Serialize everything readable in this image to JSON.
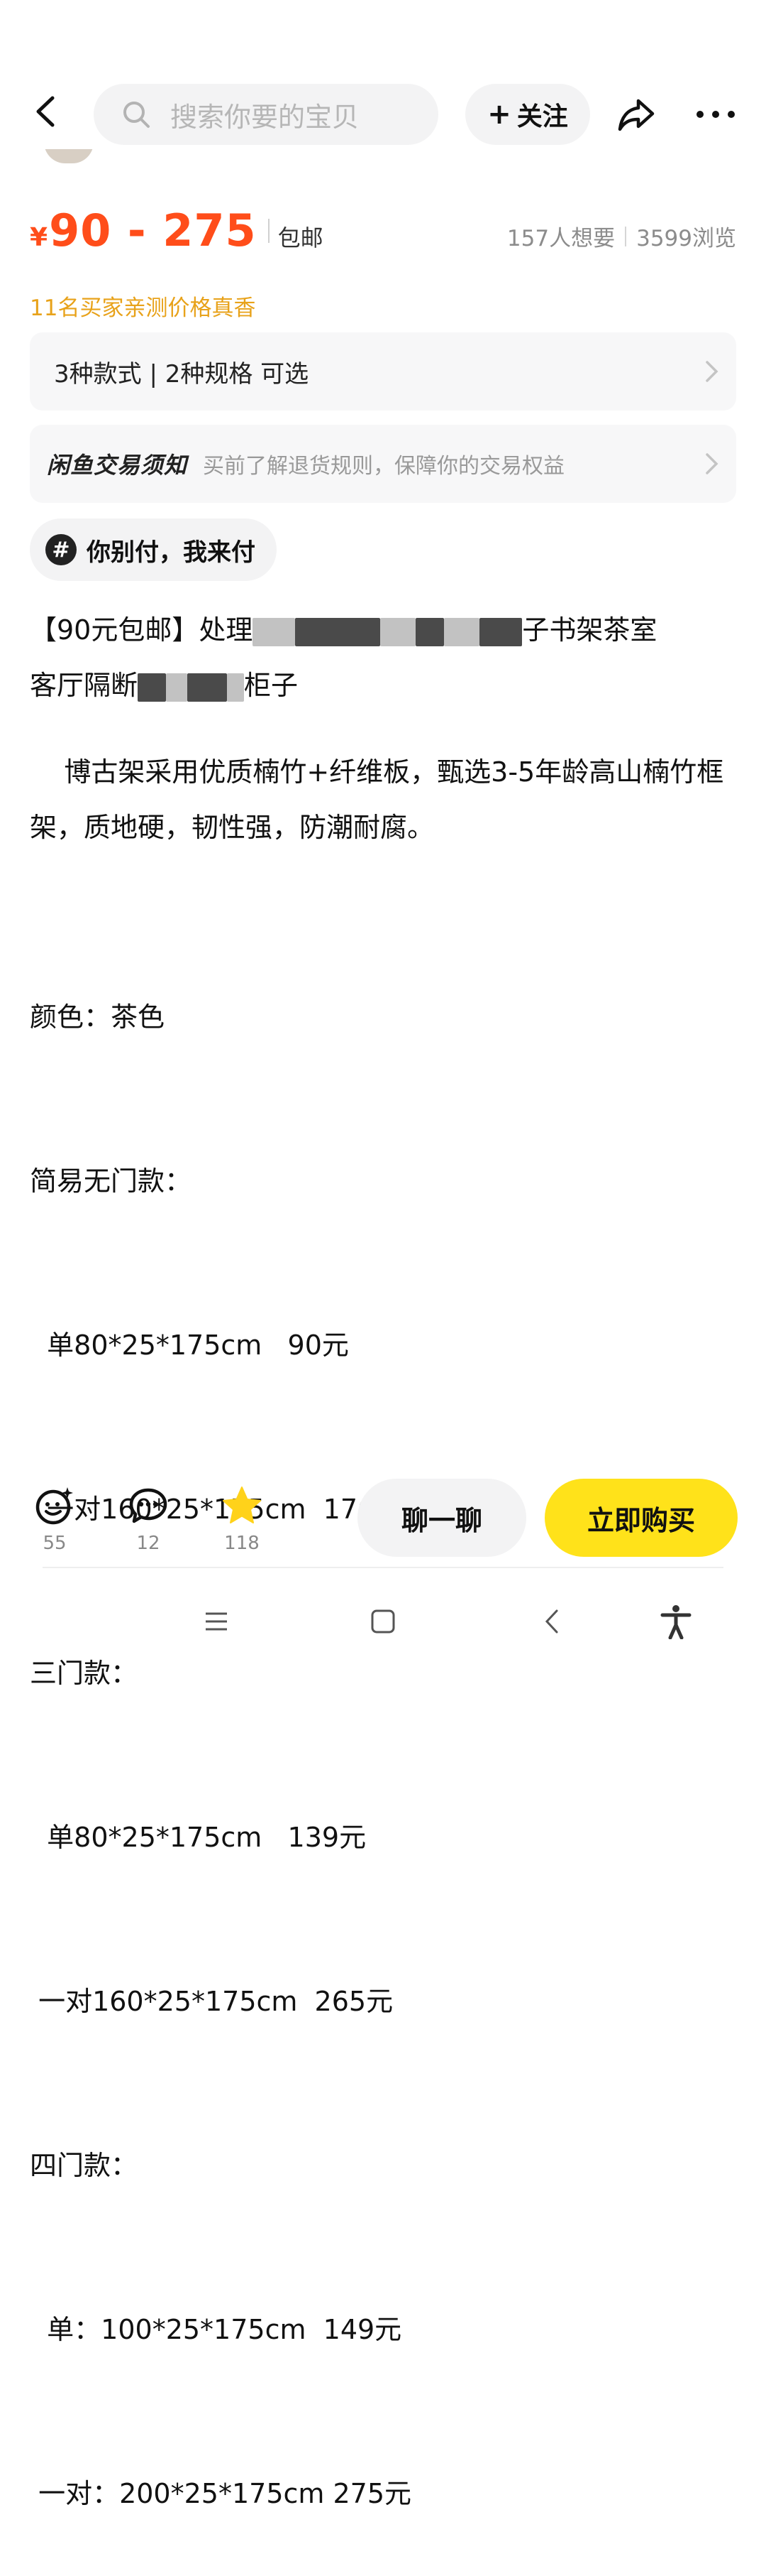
{
  "header": {
    "search_placeholder": "搜索你要的宝贝",
    "follow_label": "关注",
    "icons": [
      "back-arrow-icon",
      "search-icon",
      "share-icon",
      "more-icon"
    ]
  },
  "price": {
    "currency": "¥",
    "range": "90 - 275",
    "shipping": "包邮",
    "wants": "157人想要",
    "views": "3599浏览",
    "accent_color": "#ff4d1a"
  },
  "tested_note": "11名买家亲测价格真香",
  "options_card": "3种款式 | 2种规格 可选",
  "trade_notice": {
    "title": "闲鱼交易须知",
    "subtitle": "买前了解退货规则，保障你的交易权益"
  },
  "tag": {
    "hash": "#",
    "text": "你别付，我来付"
  },
  "item_title": {
    "start": "【90元包邮】处理",
    "part2": "子书架茶室",
    "line2_start": "客厅隔断",
    "line2_end": "柜子"
  },
  "description": "博古架采用优质楠竹+纤维板，甄选3-5年龄高山楠竹框架，质地硬，韧性强，防潮耐腐。",
  "specs": [
    "颜色：茶色",
    "简易无门款：",
    "  单80*25*175cm   90元",
    "  一对160*25*175cm  176元",
    "三门款：",
    "  单80*25*175cm   139元",
    " 一对160*25*175cm  265元",
    "四门款：",
    "  单：100*25*175cm  149元",
    " 一对：200*25*175cm 275元"
  ],
  "actions": {
    "like_count": "55",
    "comment_count": "12",
    "favorite_count": "118",
    "chat_label": "聊一聊",
    "buy_label": "立即购买",
    "buy_color": "#ffe21a"
  }
}
